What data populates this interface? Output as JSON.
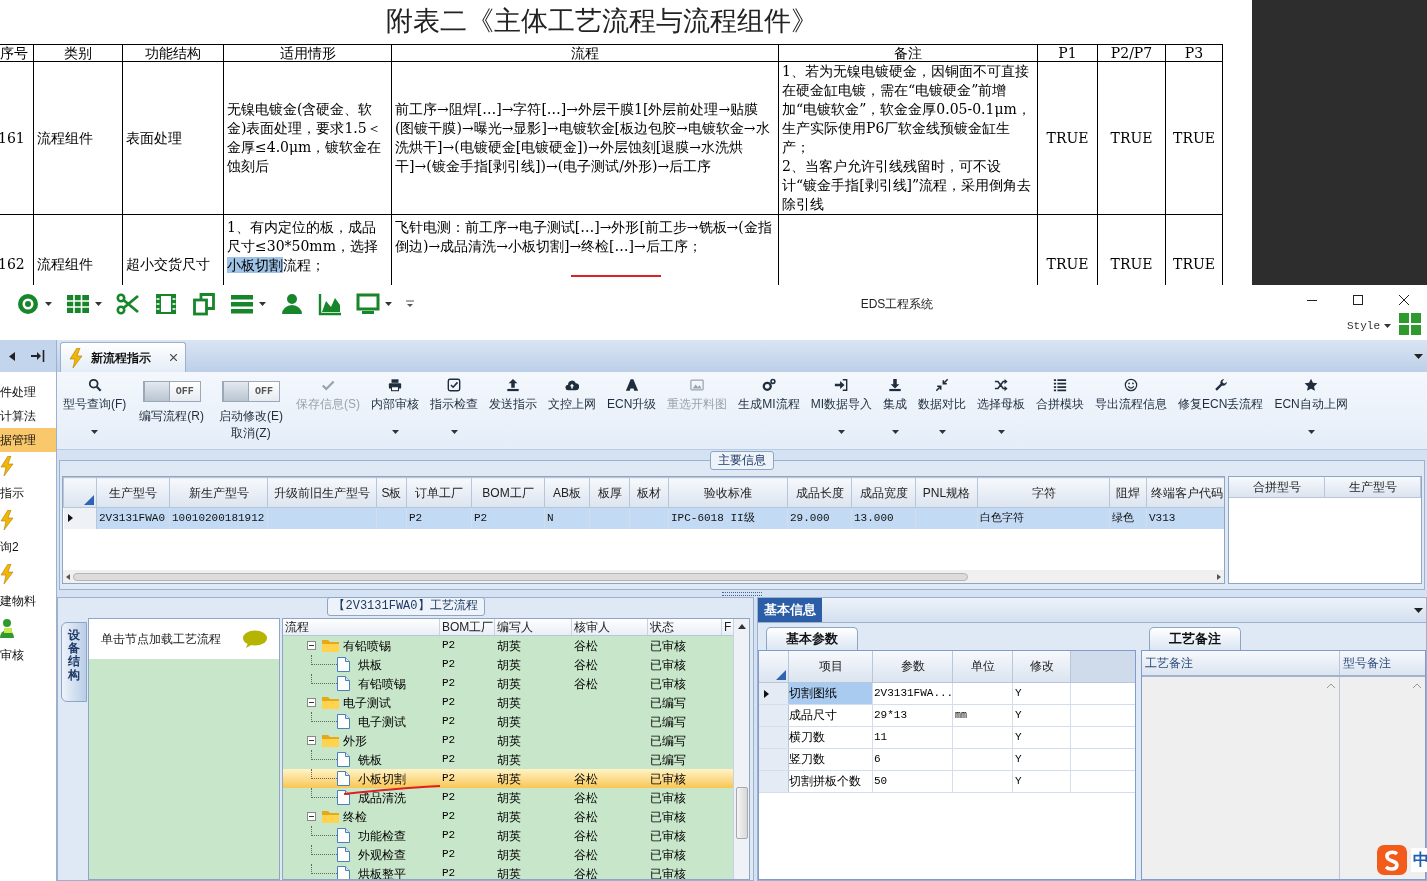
{
  "document": {
    "title": "附表二《主体工艺流程与流程组件》",
    "columns": [
      "序号",
      "类别",
      "功能结构",
      "适用情形",
      "流程",
      "备注",
      "P1",
      "P2/P7",
      "P3"
    ],
    "rows": [
      {
        "no": "161",
        "category": "流程组件",
        "function": "表面处理",
        "applicability": [
          {
            "text": "无镍电镀金(含硬金、软金)表面处理，要求1.5＜金厚≤4.0μm，镀软金在蚀刻后",
            "selected": false
          }
        ],
        "flow": "前工序→阻焊[…]→字符[…]→外层干膜1[外层前处理→贴膜(图镀干膜)→曝光→显影]→电镀软金[板边包胶→电镀软金→水洗烘干]→(电镀硬金[电镀硬金])→外层蚀刻[退膜→水洗烘干]→(镀金手指[剥引线])→(电子测试/外形)→后工序",
        "remarks": [
          "1、若为无镍电镀硬金，因铜面不可直接在硬金缸电镀，需在“电镀硬金”前增加“电镀软金”，软金金厚0.05-0.1μm，生产实际使用P6厂软金线预镀金缸生产；",
          "2、当客户允许引线残留时，可不设计“镀金手指[剥引线]”流程，采用倒角去除引线"
        ],
        "p1": "TRUE",
        "p2_p7": "TRUE",
        "p3": "TRUE"
      },
      {
        "no": "162",
        "category": "流程组件",
        "function": "超小交货尺寸",
        "applicability": [
          {
            "text": "1、有内定位的板，成品尺寸≤30*50mm，选择",
            "selected": false
          },
          {
            "text": "小板切割",
            "selected": true
          },
          {
            "text": "流程；",
            "selected": false
          }
        ],
        "flow": "飞针电测：前工序→电子测试[…]→外形[前工步→铣板→(金指倒边)→成品清洗→小板切割]→终检[…]→后工序；",
        "p1": "TRUE",
        "p2_p7": "TRUE",
        "p3": "TRUE"
      }
    ]
  },
  "window": {
    "title": "EDS工程系统",
    "style_label": "Style"
  },
  "nav": {
    "items": [
      {
        "label": "件处理",
        "kind": "text",
        "selected": false
      },
      {
        "label": "计算法",
        "kind": "text",
        "selected": false
      },
      {
        "label": "据管理",
        "kind": "text",
        "selected": true
      },
      {
        "label": "指示",
        "kind": "bolt",
        "selected": false
      },
      {
        "label": "询2",
        "kind": "bolt",
        "selected": false
      },
      {
        "label": "建物料",
        "kind": "bolt",
        "selected": false
      },
      {
        "label": "审核",
        "kind": "person",
        "selected": false
      }
    ]
  },
  "tabs": [
    {
      "label": "新流程指示",
      "selected": true,
      "closable": true
    }
  ],
  "ribbon": [
    {
      "kind": "button",
      "label": "型号查询(F)",
      "dropdown": true,
      "disabled": false
    },
    {
      "kind": "toggle",
      "label": "编写流程(R)",
      "switch_text": "OFF",
      "on": false
    },
    {
      "kind": "toggle",
      "label": "启动修改(E)",
      "sublabel": "取消(Z)",
      "switch_text": "OFF",
      "on": false
    },
    {
      "kind": "button",
      "label": "保存信息(S)",
      "dropdown": false,
      "disabled": true
    },
    {
      "kind": "button",
      "label": "内部审核",
      "dropdown": true,
      "disabled": false
    },
    {
      "kind": "button",
      "label": "指示检查",
      "dropdown": true,
      "disabled": false
    },
    {
      "kind": "button",
      "label": "发送指示",
      "dropdown": false,
      "disabled": false
    },
    {
      "kind": "button",
      "label": "文控上网",
      "dropdown": false,
      "disabled": false
    },
    {
      "kind": "button",
      "label": "ECN升级",
      "dropdown": false,
      "disabled": false
    },
    {
      "kind": "button",
      "label": "重选开料图",
      "dropdown": false,
      "disabled": true
    },
    {
      "kind": "button",
      "label": "生成MI流程",
      "dropdown": false,
      "disabled": false
    },
    {
      "kind": "button",
      "label": "MI数据导入",
      "dropdown": true,
      "disabled": false
    },
    {
      "kind": "button",
      "label": "集成",
      "dropdown": true,
      "disabled": false
    },
    {
      "kind": "button",
      "label": "数据对比",
      "dropdown": true,
      "disabled": false
    },
    {
      "kind": "button",
      "label": "选择母板",
      "dropdown": true,
      "disabled": false
    },
    {
      "kind": "button",
      "label": "合拼模块",
      "dropdown": false,
      "disabled": false
    },
    {
      "kind": "button",
      "label": "导出流程信息",
      "dropdown": false,
      "disabled": false
    },
    {
      "kind": "button",
      "label": "修复ECN丢流程",
      "dropdown": false,
      "disabled": false
    },
    {
      "kind": "button",
      "label": "ECN自动上网",
      "dropdown": true,
      "disabled": false
    }
  ],
  "main_info": {
    "title": "主要信息",
    "columns": [
      "生产型号",
      "新生产型号",
      "升级前旧生产型号",
      "S板",
      "订单工厂",
      "BOM工厂",
      "AB板",
      "板厚",
      "板材",
      "验收标准",
      "成品长度",
      "成品宽度",
      "PNL规格",
      "字符",
      "阻焊",
      "终端客户代码"
    ],
    "rows": [
      {
        "selected": true,
        "cells": [
          "2V3131FWA0",
          "10010200181912",
          null,
          null,
          "P2",
          "P2",
          "N",
          null,
          null,
          "IPC-6018 II级",
          "29.000",
          "13.000",
          null,
          "白色字符",
          "绿色",
          "V313"
        ]
      }
    ],
    "side_columns": [
      "合拼型号",
      "生产型号"
    ]
  },
  "process_tree": {
    "title": "【2V3131FWA0】工艺流程",
    "side_tab": "设备结构",
    "hint": "单击节点加载工艺流程",
    "columns": [
      "流程",
      "BOM工厂",
      "编写人",
      "核审人",
      "状态",
      "F"
    ],
    "nodes": [
      {
        "name": "有铅喷锡",
        "bom": "P2",
        "writer": "胡英",
        "reviewer": "谷松",
        "status": "已审核",
        "selected": false,
        "expanded": true,
        "children": [
          {
            "name": "烘板",
            "bom": "P2",
            "writer": "胡英",
            "reviewer": "谷松",
            "status": "已审核",
            "selected": false
          },
          {
            "name": "有铅喷锡",
            "bom": "P2",
            "writer": "胡英",
            "reviewer": "谷松",
            "status": "已审核",
            "selected": false
          }
        ]
      },
      {
        "name": "电子测试",
        "bom": "P2",
        "writer": "胡英",
        "status": "已编写",
        "selected": false,
        "expanded": true,
        "children": [
          {
            "name": "电子测试",
            "bom": "P2",
            "writer": "胡英",
            "status": "已编写",
            "selected": false
          }
        ]
      },
      {
        "name": "外形",
        "bom": "P2",
        "writer": "胡英",
        "status": "已编写",
        "selected": false,
        "expanded": true,
        "children": [
          {
            "name": "铣板",
            "bom": "P2",
            "writer": "胡英",
            "status": "已编写",
            "selected": false
          },
          {
            "name": "小板切割",
            "bom": "P2",
            "writer": "胡英",
            "reviewer": "谷松",
            "status": "已审核",
            "selected": true
          },
          {
            "name": "成品清洗",
            "bom": "P2",
            "writer": "胡英",
            "reviewer": "谷松",
            "status": "已审核",
            "selected": false
          }
        ]
      },
      {
        "name": "终检",
        "bom": "P2",
        "writer": "胡英",
        "reviewer": "谷松",
        "status": "已审核",
        "selected": false,
        "expanded": true,
        "children": [
          {
            "name": "功能检查",
            "bom": "P2",
            "writer": "胡英",
            "reviewer": "谷松",
            "status": "已审核",
            "selected": false
          },
          {
            "name": "外观检查",
            "bom": "P2",
            "writer": "胡英",
            "reviewer": "谷松",
            "status": "已审核",
            "selected": false
          },
          {
            "name": "烘板整平",
            "bom": "P2",
            "writer": "胡英",
            "reviewer": "谷松",
            "status": "已审核",
            "selected": false
          }
        ]
      }
    ]
  },
  "detail_panel": {
    "tabs": [
      {
        "label": "基本信息",
        "selected": true
      }
    ],
    "params": {
      "tab": "基本参数",
      "columns": [
        "项目",
        "参数",
        "单位",
        "修改"
      ],
      "rows": [
        {
          "item": "切割图纸",
          "value": "2V3131FWA...",
          "modified": "Y",
          "selected": true
        },
        {
          "item": "成品尺寸",
          "value": "29*13",
          "unit": "mm",
          "modified": "Y",
          "selected": false
        },
        {
          "item": "横刀数",
          "value": "11",
          "modified": "Y",
          "selected": false
        },
        {
          "item": "竖刀数",
          "value": "6",
          "modified": "Y",
          "selected": false
        },
        {
          "item": "切割拼板个数",
          "value": "50",
          "modified": "Y",
          "selected": false
        }
      ]
    },
    "remarks": {
      "tab": "工艺备注",
      "columns": [
        "工艺备注",
        "型号备注"
      ]
    }
  },
  "ime": {
    "label": "中"
  }
}
